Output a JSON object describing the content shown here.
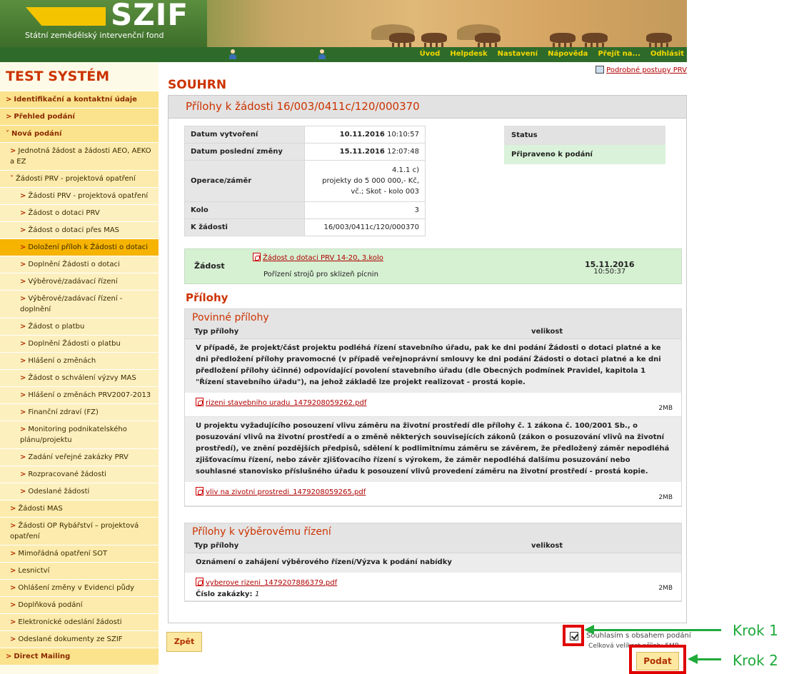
{
  "header": {
    "logo_text": "SZIF",
    "subtitle": "Státní zemědělský intervenční fond",
    "nav": [
      "Úvod",
      "Helpdesk",
      "Nastavení",
      "Nápověda",
      "Přejít na...",
      "Odhlásit"
    ]
  },
  "sidebar": {
    "title": "TEST SYSTÉM",
    "items": [
      {
        "label": "Identifikační a kontaktní údaje",
        "level": 1
      },
      {
        "label": "Přehled podání",
        "level": 1
      },
      {
        "label": "Nová podání",
        "level": 1
      },
      {
        "label": "Jednotná žádost a žádosti AEO, AEKO a EZ",
        "level": 2
      },
      {
        "label": "Žádosti PRV - projektová opatření",
        "level": 2
      },
      {
        "label": "Žádosti PRV - projektová opatření",
        "level": 3
      },
      {
        "label": "Žádost o dotaci PRV",
        "level": 3
      },
      {
        "label": "Žádost o dotaci přes MAS",
        "level": 3
      },
      {
        "label": "Doložení příloh k Žádosti o dotaci",
        "level": 3,
        "active": true
      },
      {
        "label": "Doplnění Žádosti o dotaci",
        "level": 3
      },
      {
        "label": "Výběrové/zadávací řízení",
        "level": 3
      },
      {
        "label": "Výběrové/zadávací řízení - doplnění",
        "level": 3
      },
      {
        "label": "Žádost o platbu",
        "level": 3
      },
      {
        "label": "Doplnění Žádosti o platbu",
        "level": 3
      },
      {
        "label": "Hlášení o změnách",
        "level": 3
      },
      {
        "label": "Žádost o schválení výzvy MAS",
        "level": 3
      },
      {
        "label": "Hlášení o změnách PRV2007-2013",
        "level": 3
      },
      {
        "label": "Finanční zdraví (FZ)",
        "level": 3
      },
      {
        "label": "Monitoring podnikatelského plánu/projektu",
        "level": 3
      },
      {
        "label": "Zadání veřejné zakázky PRV",
        "level": 3
      },
      {
        "label": "Rozpracované žádosti",
        "level": 3
      },
      {
        "label": "Odeslané žádosti",
        "level": 3
      },
      {
        "label": "Žádosti MAS",
        "level": 2
      },
      {
        "label": "Žádosti OP Rybářství – projektová opatření",
        "level": 2
      },
      {
        "label": "Mimořádná opatření SOT",
        "level": 2
      },
      {
        "label": "Lesnictví",
        "level": 2
      },
      {
        "label": "Ohlášení změny v Evidenci půdy",
        "level": 2
      },
      {
        "label": "Doplňková podání",
        "level": 2
      },
      {
        "label": "Elektronické odeslání žádosti",
        "level": 2
      },
      {
        "label": "Odeslané dokumenty ze SZIF",
        "level": 2
      },
      {
        "label": "Direct Mailing",
        "level": 1
      }
    ]
  },
  "main": {
    "manual_link": "Podrobné postupy PRV",
    "page_title": "SOUHRN",
    "panel_title": "Přílohy k žádosti 16/003/0411c/120/000370",
    "info": {
      "created_label": "Datum vytvoření",
      "created_date": "10.11.2016",
      "created_time": "10:10:57",
      "modified_label": "Datum poslední změny",
      "modified_date": "15.11.2016",
      "modified_time": "12:07:48",
      "operation_label": "Operace/záměr",
      "operation_line1": "4.1.1 c)",
      "operation_line2": "projekty do 5 000 000,- Kč,",
      "operation_line3": "vč.; Skot - kolo 003",
      "round_label": "Kolo",
      "round_value": "3",
      "request_label": "K žádosti",
      "request_value": "16/003/0411c/120/000370"
    },
    "status": {
      "label": "Status",
      "value": "Připraveno k podání"
    },
    "zadost": {
      "label": "Žádost",
      "link": "Žádost o dotaci PRV 14-20, 3.kolo",
      "subtitle": "Pořízení strojů pro sklizeň pícnin",
      "date": "15.11.2016",
      "time": "10:50:37"
    },
    "attachments_title": "Přílohy",
    "mandatory": {
      "title": "Povinné přílohy",
      "col_type": "Typ přílohy",
      "col_size": "velikost",
      "items": [
        {
          "description": "V případě, že projekt/část projektu podléhá řízení stavebního úřadu, pak ke dni podání Žádosti o dotaci platné a ke dni předložení přílohy pravomocné (v případě veřejnoprávní smlouvy ke dni podání Žádosti o dotaci platné a ke dni předložení přílohy účinné) odpovídající povolení stavebního úřadu (dle Obecných podmínek Pravidel, kapitola 1 \"Řízení stavebního úřadu\"), na jehož základě lze projekt realizovat - prostá kopie.",
          "file": "rizeni stavebniho uradu_1479208059262.pdf",
          "size": "2MB"
        },
        {
          "description": "U projektu vyžadujícího posouzení vlivu záměru na životní prostředí dle přílohy č. 1 zákona č. 100/2001 Sb., o posuzování vlivů na životní prostředí a o změně některých souvisejících zákonů (zákon o posuzování vlivů na životní prostředí), ve znění pozdějších předpisů, sdělení k podlimitnímu záměru se závěrem, že předložený záměr nepodléhá zjišťovacímu řízení, nebo závěr zjišťovacího řízení s výrokem, že záměr nepodléhá dalšímu posuzování nebo souhlasné stanovisko příslušného úřadu k posouzení vlivů provedení záměru na životní prostředí - prostá kopie.",
          "file": "vliv na zivotni prostredi_1479208059265.pdf",
          "size": "2MB"
        }
      ]
    },
    "selection": {
      "title": "Přílohy k výběrovému řízení",
      "col_type": "Typ přílohy",
      "col_size": "velikost",
      "description": "Oznámení o zahájení výběrového řízení/Výzva k podání nabídky",
      "file": "vyberove rizeni_1479207886379.pdf",
      "size": "2MB",
      "contract_label": "Číslo zakázky:",
      "contract_value": "1"
    },
    "total_size": "Celková velikost příloh: 5MB",
    "back_label": "Zpět",
    "agree_label": "Souhlasím s obsahem podání",
    "submit_label": "Podat"
  },
  "annotations": {
    "step1": "Krok 1",
    "step2": "Krok 2",
    "color": "#1faa3a",
    "highlight": "#e00000"
  }
}
